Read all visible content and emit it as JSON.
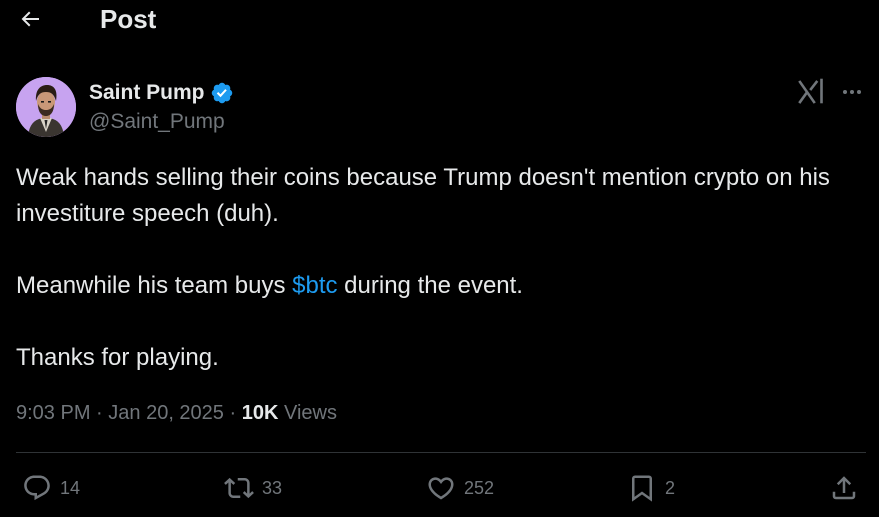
{
  "header": {
    "title": "Post",
    "back_icon": "arrow-left-icon"
  },
  "tweet": {
    "author_name": "Saint Pump",
    "author_handle": "@Saint_Pump",
    "verified_icon": "verified-badge-icon",
    "text_line1": "Weak hands selling their coins because Trump doesn't mention crypto on his investiture speech (duh).",
    "text_line2_before": "Meanwhile his team buys ",
    "cashtag": "$btc",
    "text_line2_after": " during the event.",
    "text_line3": "Thanks for playing.",
    "time": "9:03 PM",
    "date": "Jan 20, 2025",
    "views_count": "10K",
    "views_label": "Views"
  },
  "actions": {
    "replies": "14",
    "reposts": "33",
    "likes": "252",
    "bookmarks": "2"
  },
  "colors": {
    "background": "#000000",
    "text": "#e7e9ea",
    "secondary": "#71767b",
    "accent": "#1d9bf0",
    "divider": "#2f3336"
  }
}
